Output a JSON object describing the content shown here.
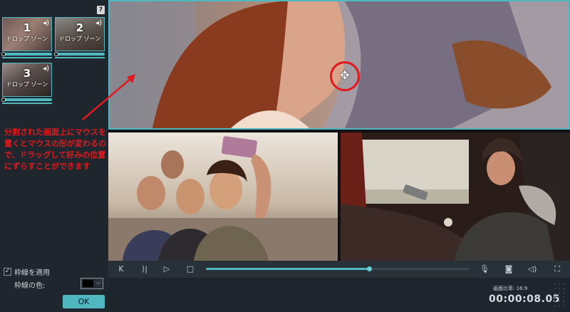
{
  "left_panel": {
    "help_label": "?",
    "slots": [
      {
        "number": "1",
        "caption": "ドロップ ゾーン"
      },
      {
        "number": "2",
        "caption": "ドロップ ゾーン"
      },
      {
        "number": "3",
        "caption": "ドロップ ゾーン"
      }
    ],
    "annotation": "分割された画面上にマウスを置くとマウスの形が変わるので、ドラッグして好みの位置にずらすことができます",
    "border_toggle": {
      "checked": true,
      "label": "枠線を適用"
    },
    "border_color": {
      "label": "枠線の色:",
      "value": "#000000"
    },
    "ok_label": "OK"
  },
  "controls": {
    "icons": [
      "skip-back-icon",
      "skip-forward-icon",
      "play-icon",
      "stop-icon",
      "microphone-icon",
      "camera-icon",
      "volume-icon",
      "fullscreen-icon"
    ],
    "progress": 0.62
  },
  "info": {
    "aspect_ratio": "画面比率: 16:9",
    "timecode": "00:00:08.05"
  },
  "colors": {
    "accent": "#4fb7bf",
    "annotation": "#e1191d"
  }
}
